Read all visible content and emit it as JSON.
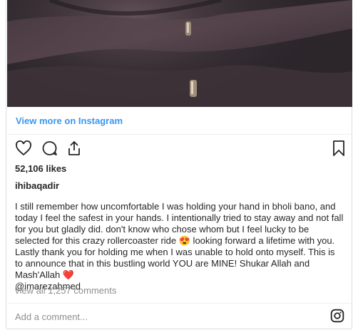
{
  "embed": {
    "view_more_label": "View more on Instagram",
    "likes_text": "52,106 likes",
    "username": "ihibaqadir",
    "caption_main": "I still remember how uncomfortable I was holding your hand in bholi bano, and today I feel the safest in your hands. I intentionally tried to stay away and not fall for you but gladly did. don't know who chose whom but I feel lucky to be selected for this crazy rollercoaster ride 😍 looking forward a lifetime with you. Lastly thank you for holding me when I was unable to hold onto myself. This is to announce that in this bustling world YOU are MINE! Shukar Allah and Mash'Allah ❤️",
    "caption_mention": "@imarezahmed",
    "comments_link": "view all 1,257 comments",
    "add_comment_placeholder": "Add a comment...",
    "icons": {
      "like": "heart-icon",
      "comment": "comment-icon",
      "share": "share-icon",
      "save": "bookmark-icon",
      "brand": "instagram-icon"
    },
    "colors": {
      "link_blue": "#3897f0",
      "text": "#262626",
      "muted": "#8e8e8e",
      "border": "#dbdbdb"
    }
  }
}
